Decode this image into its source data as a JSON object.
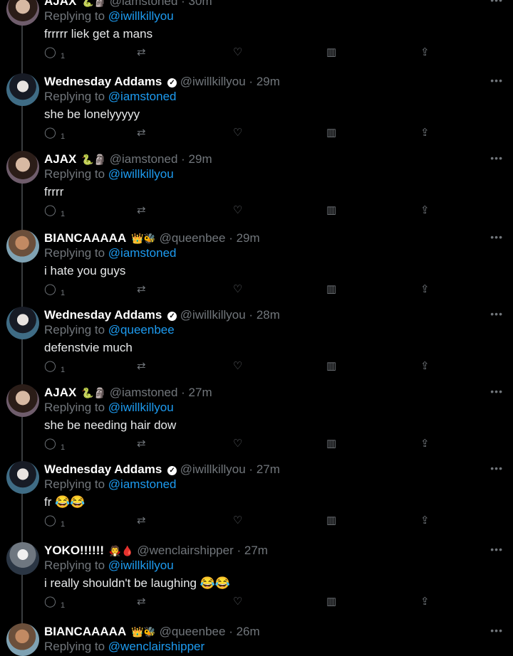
{
  "tweets": [
    {
      "avatar": "ajax-avatar",
      "name": "AJAX",
      "badges": "🐍🗿",
      "handle": "@iamstoned",
      "time": "30m",
      "reply_label": "Replying to",
      "reply_to": "@iwillkillyou",
      "text": "frrrrr liek get a mans",
      "reply_count": "1"
    },
    {
      "avatar": "wednesday-avatar",
      "name": "Wednesday Addams",
      "verified": "✓",
      "handle": "@iwillkillyou",
      "time": "29m",
      "reply_label": "Replying to",
      "reply_to": "@iamstoned",
      "text": "she be lonelyyyyy",
      "reply_count": "1"
    },
    {
      "avatar": "ajax-avatar",
      "name": "AJAX",
      "badges": "🐍🗿",
      "handle": "@iamstoned",
      "time": "29m",
      "reply_label": "Replying to",
      "reply_to": "@iwillkillyou",
      "text": "frrrr",
      "reply_count": "1"
    },
    {
      "avatar": "bianca-avatar",
      "name": "BIANCAAAAA",
      "badges": "👑🐝",
      "handle": "@queenbee",
      "time": "29m",
      "reply_label": "Replying to",
      "reply_to": "@iamstoned",
      "text": "i hate you guys",
      "reply_count": "1"
    },
    {
      "avatar": "wednesday-avatar",
      "name": "Wednesday Addams",
      "verified": "✓",
      "handle": "@iwillkillyou",
      "time": "28m",
      "reply_label": "Replying to",
      "reply_to": "@queenbee",
      "text": "defenstvie much",
      "reply_count": "1"
    },
    {
      "avatar": "ajax-avatar",
      "name": "AJAX",
      "badges": "🐍🗿",
      "handle": "@iamstoned",
      "time": "27m",
      "reply_label": "Replying to",
      "reply_to": "@iwillkillyou",
      "text": "she be needing hair dow",
      "reply_count": "1"
    },
    {
      "avatar": "wednesday-avatar",
      "name": "Wednesday Addams",
      "verified": "✓",
      "handle": "@iwillkillyou",
      "time": "27m",
      "reply_label": "Replying to",
      "reply_to": "@iamstoned",
      "text": "fr 😂😂",
      "reply_count": "1"
    },
    {
      "avatar": "yoko-avatar",
      "name": "YOKO!!!!!!",
      "badges": "🧛🩸",
      "handle": "@wenclairshipper",
      "time": "27m",
      "reply_label": "Replying to",
      "reply_to": "@iwillkillyou",
      "text": "i really shouldn't be laughing 😂😂",
      "reply_count": "1"
    },
    {
      "avatar": "bianca-avatar",
      "name": "BIANCAAAAA",
      "badges": "👑🐝",
      "handle": "@queenbee",
      "time": "26m",
      "reply_label": "Replying to",
      "reply_to": "@wenclairshipper",
      "text": "",
      "reply_count": ""
    }
  ],
  "icons": {
    "comment": "comment-icon",
    "retweet": "retweet-icon",
    "like": "heart-icon",
    "stats": "bar-chart-icon",
    "share": "share-icon",
    "more": "more-icon"
  },
  "colors": {
    "background": "#000000",
    "text": "#e7e9ea",
    "muted": "#71767b",
    "link": "#1d9bf0"
  }
}
